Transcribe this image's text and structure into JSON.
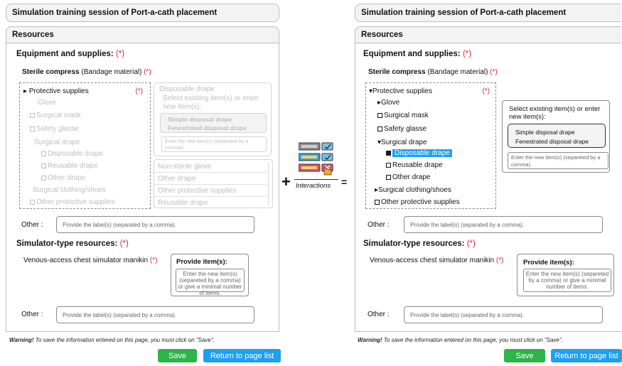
{
  "left": {
    "title": "Simulation training session of Port-a-cath placement",
    "resources": "Resources",
    "equip_label": "Equipment and supplies:",
    "req": "(*)",
    "sterile_bold": "Sterile compress",
    "sterile_rest": " (Bandage material)",
    "tree": {
      "root": "▸ Protective supplies",
      "req": "(*)",
      "items": [
        "Glove",
        "Surgical mask",
        "Safety glasse",
        "Surgical drape",
        "Disposable drape",
        "Reusable drape",
        "Other drape",
        "Surgical clothing/shoes",
        "Other protective supplies"
      ]
    },
    "right_panel": {
      "top": "Disposable drape",
      "select_hint": "Select existing item(s) or enter new item(s):",
      "options": [
        "Simple disposal drape",
        "Fenestrated disposal drape"
      ],
      "enter_placeholder": "Enter the new item(s) (separated by a comma).",
      "list": [
        "Non-sterile glove",
        "Other drape",
        "Other protective supplies",
        "Reusable drape"
      ]
    },
    "other_label": "Other :",
    "other_placeholder": "Provide the label(s) (separated by a comma).",
    "sim_label": "Simulator-type resources:",
    "manikin": "Venous-access chest simulator manikin",
    "provide_title": "Provide item(s):",
    "provide_placeholder": "Enter the new item(s) (separeted by a comma) or give a minimal number of items.",
    "other2_label": "Other :",
    "other2_placeholder": "Provide the label(s) (separated by a comma).",
    "warning_bold": "Warning!",
    "warning_text": " To save the information entered on this page, you must click on \"Save\".",
    "save": "Save",
    "return": "Return to page list"
  },
  "middle": {
    "plus": "+",
    "interactions": "Interactions",
    "equals": "="
  },
  "right": {
    "title": "Simulation training session of Port-a-cath placement",
    "resources": "Resources",
    "equip_label": "Equipment and supplies:",
    "req": "(*)",
    "sterile_bold": "Sterile compress",
    "sterile_rest": " (Bandage material)",
    "tree": {
      "root": "▾Protective supplies",
      "req": "(*)",
      "glove": "▸Glove",
      "mask": "Surgical mask",
      "safety": "Safety glasse",
      "drape": "▾Surgical drape",
      "disposable": "Disposable drape",
      "reusable": "Reusable drape",
      "other_drape": "Other drape",
      "clothing": "▸Surgical clothing/shoes",
      "other_prot": "Other protective supplies"
    },
    "select_hint": "Select existing item(s) or enter new item(s):",
    "options": [
      "Simple disposal drape",
      "Fenestrated disposal drape"
    ],
    "enter_placeholder": "Enter the new item(s) (separeted by a comma).",
    "other_label": "Other :",
    "other_placeholder": "Provide the label(s) (separated by a comma).",
    "sim_label": "Simulator-type resources:",
    "manikin": "Venous-access chest simulator manikin",
    "provide_title": "Provide item(s):",
    "provide_placeholder": "Enter the new item(s) (separeted by a comma) or give a minimal number of items.",
    "other2_label": "Other :",
    "other2_placeholder": "Provide the label(s) (separated by a comma).",
    "warning_bold": "Warning!",
    "warning_text": " To save the information entered on this page, you must click on \"Save\".",
    "save": "Save",
    "return": "Return to page list"
  }
}
